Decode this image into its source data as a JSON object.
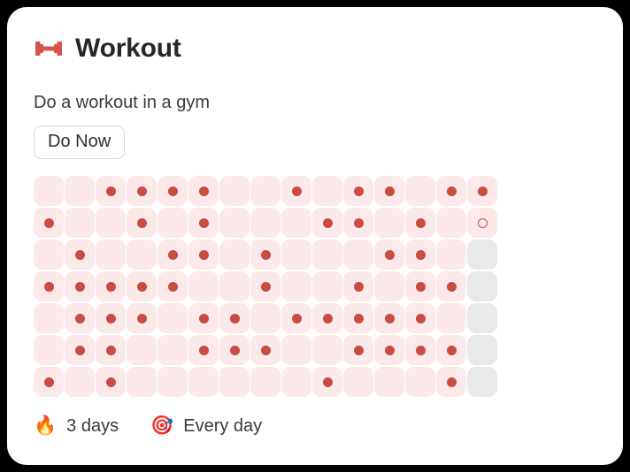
{
  "card": {
    "icon": "dumbbell-icon",
    "icon_color": "#d5534a",
    "title": "Workout",
    "description": "Do a workout in a gym",
    "action_button_label": "Do Now",
    "background_color": "#ffffff"
  },
  "heatmap": {
    "columns": 15,
    "rows": 7,
    "colors": {
      "empty_past": "#fce9e9",
      "future": "#e9e9e9",
      "done_dot": "#ca4b42",
      "today_ring": "#ca4b42"
    },
    "legend": {
      "done": "completed day",
      "empty_past": "missed day",
      "today": "today (not yet completed)",
      "future": "future day"
    },
    "cells": [
      [
        "empty",
        "empty",
        "done",
        "done",
        "done",
        "done",
        "empty",
        "empty",
        "done",
        "empty",
        "done",
        "done",
        "empty",
        "done",
        "done"
      ],
      [
        "done",
        "empty",
        "empty",
        "done",
        "empty",
        "done",
        "empty",
        "empty",
        "empty",
        "done",
        "done",
        "empty",
        "done",
        "empty",
        "today"
      ],
      [
        "empty",
        "done",
        "empty",
        "empty",
        "done",
        "done",
        "empty",
        "done",
        "empty",
        "empty",
        "empty",
        "done",
        "done",
        "empty",
        "future"
      ],
      [
        "done",
        "done",
        "done",
        "done",
        "done",
        "empty",
        "empty",
        "done",
        "empty",
        "empty",
        "done",
        "empty",
        "done",
        "done",
        "future"
      ],
      [
        "empty",
        "done",
        "done",
        "done",
        "empty",
        "done",
        "done",
        "empty",
        "done",
        "done",
        "done",
        "done",
        "done",
        "empty",
        "future"
      ],
      [
        "empty",
        "done",
        "done",
        "empty",
        "empty",
        "done",
        "done",
        "done",
        "empty",
        "empty",
        "done",
        "done",
        "done",
        "done",
        "future"
      ],
      [
        "done",
        "empty",
        "done",
        "empty",
        "empty",
        "empty",
        "empty",
        "empty",
        "empty",
        "done",
        "empty",
        "empty",
        "empty",
        "done",
        "future"
      ]
    ]
  },
  "footer": {
    "streak": {
      "emoji": "🔥",
      "icon": "fire-icon",
      "label": "3 days"
    },
    "frequency": {
      "emoji": "🎯",
      "icon": "target-icon",
      "label": "Every day"
    }
  }
}
